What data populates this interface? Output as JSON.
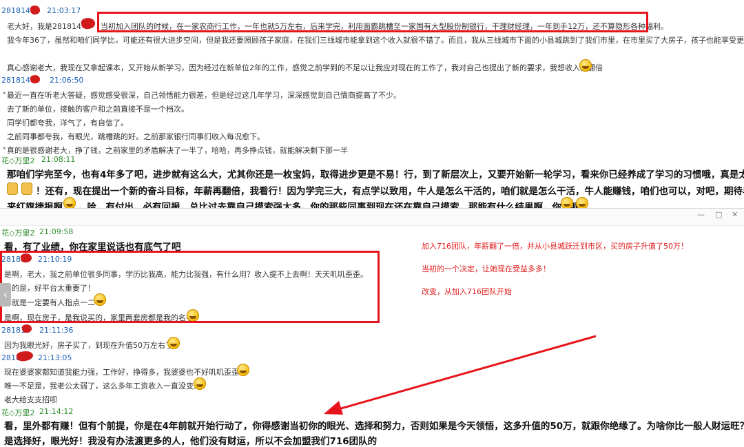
{
  "top": {
    "m1": {
      "sender": "281814",
      "time": "21:03:17",
      "line1_pre": "老大好，我是281814",
      "line1_box": "当初加入团队的时候，在一家农商行工作，一年也就5万左右，后来学完，利用面霸跳槽至一家国有大型股份制银行，干理财经理，一年到手12万，还不算隐形各种福利。",
      "line2": "我今年36了，虽然和咱们同学比，可能还有很大进步空间，但是我还要照顾孩子家庭，在我们三线城市能拿到这个收入就很不错了。而且，我从三线城市下面的小县城跳到了我们市里，在市里买了大房子，孩子也能享受更好的教",
      "line3": "真心感谢老大，我现在又拿起课本，又开始从新学习，因为经过在新单位2年的工作，感觉之前学到的不足以让我应对现在的工作了，我对自己也提出了新的要求，我想收入再翻倍"
    },
    "m2": {
      "sender": "281814",
      "time": "21:06:50",
      "l1": "最近一直在听老大答疑，感觉感受很深，自己领悟能力很差，但是经过这几年学习，深深感觉到自己情商提高了不少。",
      "l2": "去了新的单位，接触的客户和之前直接不是一个档次。",
      "l3": "同学们都夸我，洋气了，有自信了。",
      "l4": "之前同事都夸我，有眼光，跳槽跳的好。之前那家银行同事们收入每况愈下。",
      "l5": "真的是很感谢老大，挣了钱，之前家里的矛盾解决了一半了，哈哈，再多挣点钱，就能解决剩下那一半"
    },
    "m3": {
      "sender": "花◇万里2",
      "time": "21:08:11",
      "l1": "那咱们学完至今，也有4年多了吧，进步就有这么大，尤其你还是一枚宝妈，取得进步更是不易！行，到了新层次上，又要开始新一轮学习，看来你已经养成了学习的习惯哦，真是太棒了",
      "l2": "！还有，现在提出一个新的奋斗目标，年薪再翻倍，我看行！因为学完三大，有点学以致用，牛人是怎么干活的，咱们就是怎么干活，牛人能赚钱，咱们也可以，对吧，期待早日传",
      "l3a": "来红旗捷报啊",
      "l3b": "，哈，有付出，必有回报，总比过去靠自己摸索强太多，你的那些同事到现在还在靠自己摸索，那能有什么结果啊，你说呢"
    }
  },
  "window_controls": {
    "min": "—",
    "max": "□",
    "close": "✕"
  },
  "bottom": {
    "m4": {
      "sender": "花◇万里2",
      "time": "21:09:58",
      "text": "看，有了业绩，你在家里说话也有底气了吧"
    },
    "m5": {
      "sender": "281814",
      "time": "21:10:19",
      "l1": "是啊，老大，我之前单位很多同事，学历比我高，能力比我强，有什么用？收入提不上去啊！天天叽叽歪歪。",
      "l2": "真的是，好平台太重要了！",
      "l3": "再就是一定要有人指点一二",
      "l4": "是啊，现在房子，是我说买的，家里两套房都是我的名字"
    },
    "m6": {
      "sender": "281814",
      "time": "21:11:36",
      "text": "因为我眼光好，房子买了，到现在升值50万左右了"
    },
    "m7": {
      "sender": "281814",
      "time": "21:13:05",
      "l1": "现在婆婆家都知道我能力强，工作好，挣得多，我婆婆也不好叽叽歪歪了",
      "l2": "唯一不足是，我老公太弱了，这么多年工资收入一直没变过",
      "l3": "老大给支支招呗"
    },
    "m8": {
      "sender": "花◇万里2",
      "time": "21:14:12",
      "l1": "看，里外都有赚！但有个前提，你是在4年前就开始行动了，你得感谢当初你的眼光、选择和努力，否则如果是今天领悟，这多升值的50万，就跟你绝缘了。为啥你比一般人财运旺？本质就",
      "l2": "是选择好，眼光好！我没有办法渡更多的人，他们没有财运，所以不会加盟我们716团队的"
    },
    "annotations": {
      "a1": "加入716团队，年薪翻了一倍，并从小县城跃迁到市区，买的房子升值了50万！",
      "a2": "当初的一个决定，让她现在受益多多！",
      "a3": "改变，从加入716团队开始"
    }
  },
  "colors": {
    "highlight_red": "#e8141c",
    "sender_blue": "#1a5fb4",
    "sender_green": "#2e8b2e"
  }
}
